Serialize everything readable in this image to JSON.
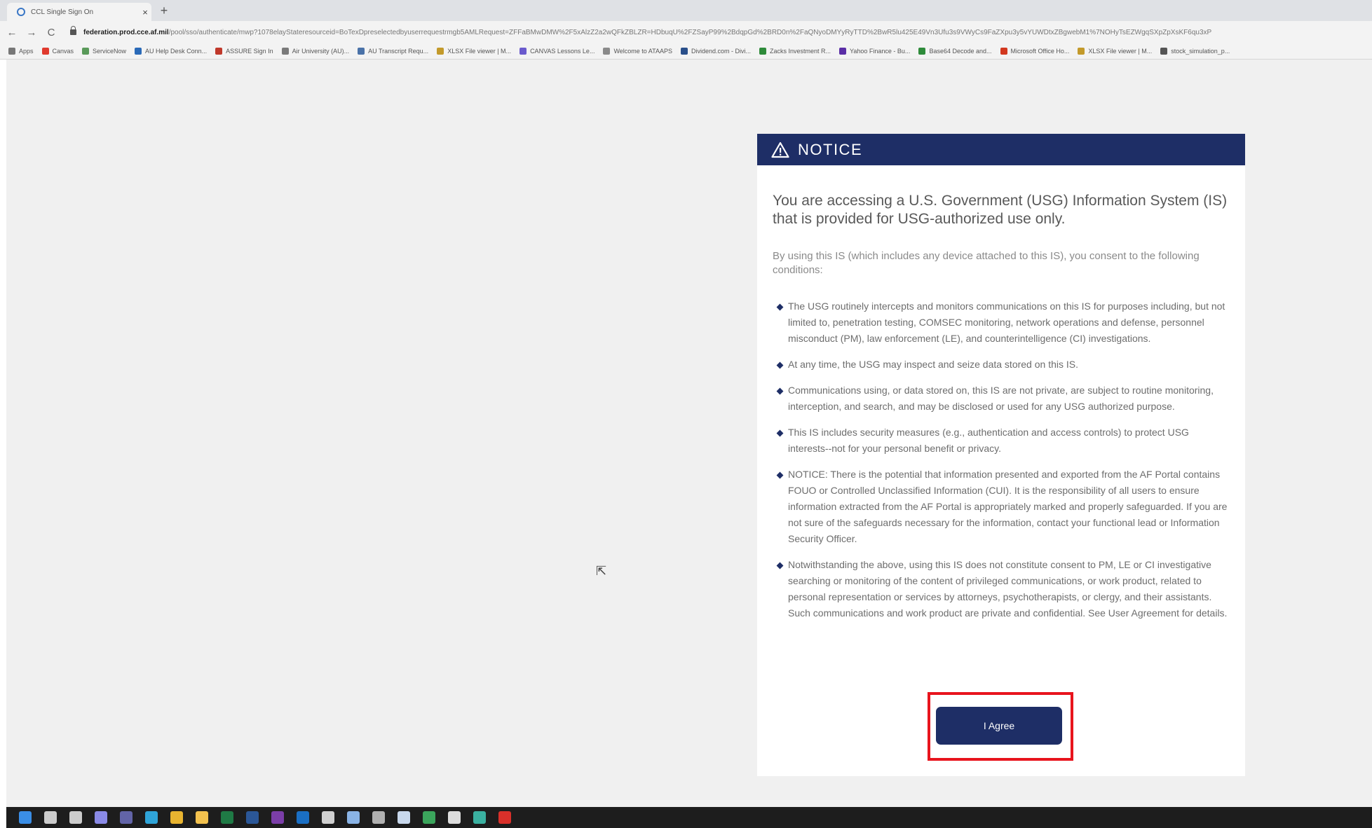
{
  "browser": {
    "tab_title": "CCL Single Sign On",
    "tab_close": "×",
    "new_tab": "+",
    "nav": {
      "back": "←",
      "forward": "→",
      "reload": "C"
    },
    "url_host": "federation.prod.cce.af.mil",
    "url_path": "/pool/sso/authenticate/mwp?1078elayStateresourceid=BoTexDpreselectedbyuserrequestrmgb5AMLRequest=ZFFaBMwDMW%2F5xAlzZ2a2wQFkZBLZR=HDbuqU%2FZSayP99%2BdqpGd%2BRD0n%2FaQNyoDMYyRyTTD%2BwR5lu425E49Vn3Ufu3s9VWyCs9FaZXpu3y5vYUWDtxZBgwebM1%7NOHyTsEZWgqSXpZpXsKF6qu3xP"
  },
  "bookmarks": [
    {
      "label": "Apps",
      "color": "#777777"
    },
    {
      "label": "Canvas",
      "color": "#e03a2e"
    },
    {
      "label": "ServiceNow",
      "color": "#5a9a5a"
    },
    {
      "label": "AU Help Desk Conn...",
      "color": "#2a6ab8"
    },
    {
      "label": "ASSURE Sign In",
      "color": "#c0392b"
    },
    {
      "label": "Air University (AU)...",
      "color": "#7a7a7a"
    },
    {
      "label": "AU Transcript Requ...",
      "color": "#4a72a8"
    },
    {
      "label": "XLSX File viewer | M...",
      "color": "#c39a2b"
    },
    {
      "label": "CANVAS Lessons Le...",
      "color": "#6a5acd"
    },
    {
      "label": "Welcome to ATAAPS",
      "color": "#8a8a8a"
    },
    {
      "label": "Dividend.com - Divi...",
      "color": "#2a4f8a"
    },
    {
      "label": "Zacks Investment R...",
      "color": "#2e8b3a"
    },
    {
      "label": "Yahoo Finance - Bu...",
      "color": "#5a2ea6"
    },
    {
      "label": "Base64 Decode and...",
      "color": "#2e8b3a"
    },
    {
      "label": "Microsoft Office Ho...",
      "color": "#d2381f"
    },
    {
      "label": "XLSX File viewer | M...",
      "color": "#c39a2b"
    },
    {
      "label": "stock_simulation_p...",
      "color": "#555555"
    }
  ],
  "notice": {
    "title": "NOTICE",
    "lead": "You are accessing a U.S. Government (USG) Information System (IS) that is provided for USG-authorized use only.",
    "intro": "By using this IS (which includes any device attached to this IS), you consent to the following conditions:",
    "conditions": [
      "The USG routinely intercepts and monitors communications on this IS for purposes including, but not limited to, penetration testing, COMSEC monitoring, network operations and defense, personnel misconduct (PM), law enforcement (LE), and counterintelligence (CI) investigations.",
      "At any time, the USG may inspect and seize data stored on this IS.",
      "Communications using, or data stored on, this IS are not private, are subject to routine monitoring, interception, and search, and may be disclosed or used for any USG authorized purpose.",
      "This IS includes security measures (e.g., authentication and access controls) to protect USG interests--not for your personal benefit or privacy.",
      "NOTICE: There is the potential that information presented and exported from the AF Portal contains FOUO or Controlled Unclassified Information (CUI). It is the responsibility of all users to ensure information extracted from the AF Portal is appropriately marked and properly safeguarded. If you are not sure of the safeguards necessary for the information, contact your functional lead or Information Security Officer.",
      "Notwithstanding the above, using this IS does not constitute consent to PM, LE or CI investigative searching or monitoring of the content of privileged communications, or work product, related to personal representation or services by attorneys, psychotherapists, or clergy, and their assistants. Such communications and work product are private and confidential. See User Agreement for details."
    ],
    "agree_label": "I Agree",
    "highlight_color": "#e8141d",
    "header_color": "#1e2e66"
  },
  "taskbar_icons": [
    {
      "name": "start-icon",
      "color": "#3a8ee6"
    },
    {
      "name": "search-icon",
      "color": "#cccccc"
    },
    {
      "name": "task-view-icon",
      "color": "#cccccc"
    },
    {
      "name": "cortana-icon",
      "color": "#8a8ae6"
    },
    {
      "name": "teams-icon",
      "color": "#6264a7"
    },
    {
      "name": "edge-icon",
      "color": "#2fa4d8"
    },
    {
      "name": "chrome-icon",
      "color": "#e8b430"
    },
    {
      "name": "file-explorer-icon",
      "color": "#f2c14e"
    },
    {
      "name": "excel-icon",
      "color": "#1f7a45"
    },
    {
      "name": "word-icon",
      "color": "#2b5797"
    },
    {
      "name": "onenote-icon",
      "color": "#7b3ea8"
    },
    {
      "name": "outlook-icon",
      "color": "#1a6fc4"
    },
    {
      "name": "paint-icon",
      "color": "#d0d0d0"
    },
    {
      "name": "notepad-icon",
      "color": "#8ab4e6"
    },
    {
      "name": "settings-icon",
      "color": "#b0b0b0"
    },
    {
      "name": "mail-icon",
      "color": "#c8d8ec"
    },
    {
      "name": "photos-icon",
      "color": "#3ba55c"
    },
    {
      "name": "chrome-2-icon",
      "color": "#dddddd"
    },
    {
      "name": "edge-2-icon",
      "color": "#3ab0a0"
    },
    {
      "name": "acrobat-icon",
      "color": "#d9302a"
    }
  ],
  "cursor": "⇱"
}
